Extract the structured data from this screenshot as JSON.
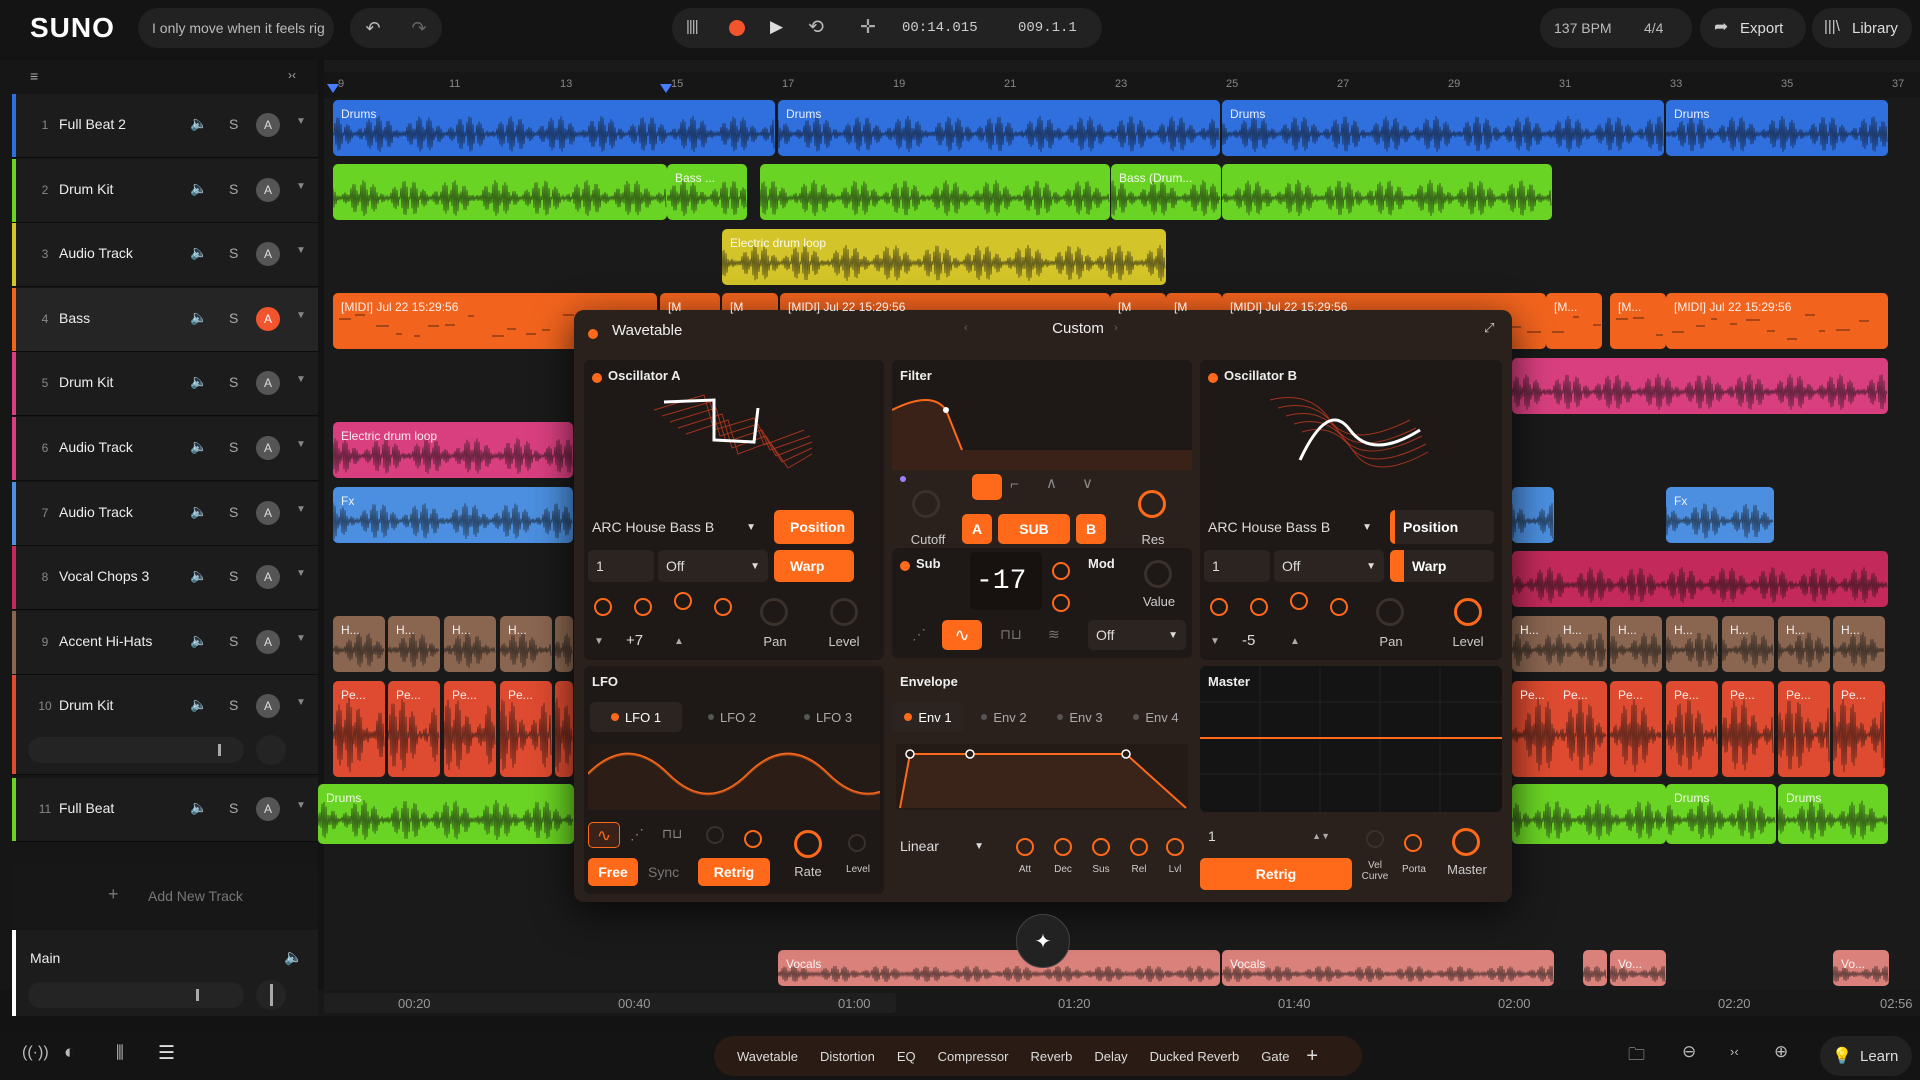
{
  "app": {
    "logo": "SUNO",
    "project_title": "I only move when it feels rig"
  },
  "transport": {
    "time": "00:14.015",
    "bar": "009.1.1",
    "bpm": "137 BPM",
    "signature": "4/4",
    "export_label": "Export",
    "library_label": "Library"
  },
  "colors": {
    "accent": "#ff6a1a",
    "blue": "#2f6fde",
    "green": "#6ad424",
    "yellow": "#d3c429",
    "orange": "#f2641e",
    "pink": "#d93f7f",
    "skyblue": "#4c8fe0",
    "magenta": "#c32a5b",
    "brown": "#8a6651",
    "red": "#de4b30",
    "salmon": "#d9817a"
  },
  "ruler": {
    "bars": [
      "9",
      "11",
      "13",
      "15",
      "17",
      "19",
      "21",
      "23",
      "25",
      "27",
      "29",
      "31",
      "33",
      "35",
      "37"
    ],
    "times": [
      "00:20",
      "00:40",
      "01:00",
      "01:20",
      "01:40",
      "02:00",
      "02:20",
      "02:56"
    ]
  },
  "tracks": [
    {
      "num": "1",
      "name": "Full Beat 2",
      "color": "#2f6fde",
      "arm": "A"
    },
    {
      "num": "2",
      "name": "Drum Kit",
      "color": "#6ad424",
      "arm": "A"
    },
    {
      "num": "3",
      "name": "Audio Track",
      "color": "#d3c429",
      "arm": "A"
    },
    {
      "num": "4",
      "name": "Bass",
      "color": "#f2641e",
      "arm": "A"
    },
    {
      "num": "5",
      "name": "Drum Kit",
      "color": "#d93f7f",
      "arm": "A"
    },
    {
      "num": "6",
      "name": "Audio Track",
      "color": "#d93f7f",
      "arm": "A"
    },
    {
      "num": "7",
      "name": "Audio Track",
      "color": "#4c8fe0",
      "arm": "A"
    },
    {
      "num": "8",
      "name": "Vocal Chops 3",
      "color": "#c32a5b",
      "arm": "A"
    },
    {
      "num": "9",
      "name": "Accent Hi-Hats",
      "color": "#8a6651",
      "arm": "A"
    },
    {
      "num": "10",
      "name": "Drum Kit",
      "color": "#de4b30",
      "arm": "A"
    },
    {
      "num": "11",
      "name": "Full Beat",
      "color": "#6ad424",
      "arm": "A"
    }
  ],
  "track_controls": {
    "solo": "S"
  },
  "add_track_label": "Add New Track",
  "main_label": "Main",
  "clips": {
    "drums": "Drums",
    "bass_short": "Bass ...",
    "bass_drum": "Bass (Drum...",
    "electric_drum_loop": "Electric drum loop",
    "midi_full": "[MIDI] Jul 22 15:29:56",
    "midi_short": "[M...",
    "midi_m": "[M",
    "fx": "Fx",
    "hihat": "H...",
    "perc": "Pe...",
    "vocals": "Vocals",
    "vo": "Vo..."
  },
  "plugin": {
    "name": "Wavetable",
    "preset": "Custom",
    "osc_a": {
      "title": "Oscillator A",
      "wavetable": "ARC House Bass B",
      "position": "Position",
      "warp": "Warp",
      "octave": "1",
      "mode": "Off",
      "semi": "+7",
      "pan": "Pan",
      "level": "Level"
    },
    "filter": {
      "title": "Filter",
      "cutoff": "Cutoff",
      "res": "Res",
      "route_a": "A",
      "route_sub": "SUB",
      "route_b": "B"
    },
    "sub": {
      "title": "Sub",
      "value": "-17"
    },
    "mod": {
      "title": "Mod",
      "value_label": "Value",
      "target": "Off"
    },
    "osc_b": {
      "title": "Oscillator B",
      "wavetable": "ARC House Bass B",
      "position": "Position",
      "warp": "Warp",
      "octave": "1",
      "mode": "Off",
      "semi": "-5",
      "pan": "Pan",
      "level": "Level"
    },
    "lfo": {
      "title": "LFO",
      "tabs": [
        "LFO 1",
        "LFO 2",
        "LFO 3"
      ],
      "free": "Free",
      "sync": "Sync",
      "retrig": "Retrig",
      "rate": "Rate",
      "level": "Level"
    },
    "envelope": {
      "title": "Envelope",
      "tabs": [
        "Env 1",
        "Env 2",
        "Env 3",
        "Env 4"
      ],
      "curve": "Linear",
      "att": "Att",
      "dec": "Dec",
      "sus": "Sus",
      "rel": "Rel",
      "lvl": "Lvl"
    },
    "master": {
      "title": "Master",
      "voices": "1",
      "retrig": "Retrig",
      "vel_curve": "Vel Curve",
      "porta": "Porta",
      "master": "Master"
    }
  },
  "fx_chain": [
    "Wavetable",
    "Distortion",
    "EQ",
    "Compressor",
    "Reverb",
    "Delay",
    "Ducked Reverb",
    "Gate"
  ],
  "bottom": {
    "learn": "Learn"
  }
}
